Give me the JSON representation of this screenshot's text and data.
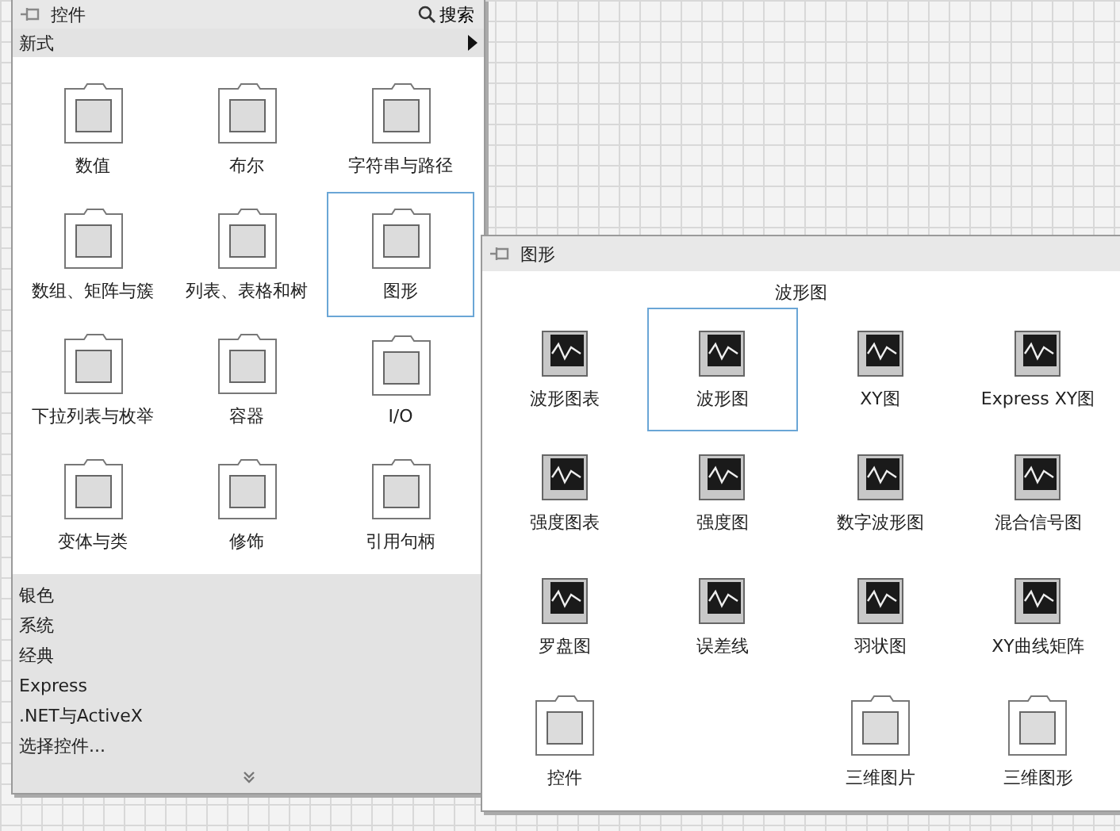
{
  "palette": {
    "title": "控件",
    "search": "搜索",
    "category": "新式",
    "items": [
      {
        "label": "数值",
        "kind": "folder",
        "selected": false
      },
      {
        "label": "布尔",
        "kind": "folder",
        "selected": false
      },
      {
        "label": "字符串与路径",
        "kind": "folder",
        "selected": false
      },
      {
        "label": "数组、矩阵与簇",
        "kind": "folder",
        "selected": false
      },
      {
        "label": "列表、表格和树",
        "kind": "folder",
        "selected": false
      },
      {
        "label": "图形",
        "kind": "folder",
        "selected": true
      },
      {
        "label": "下拉列表与枚举",
        "kind": "folder",
        "selected": false
      },
      {
        "label": "容器",
        "kind": "folder",
        "selected": false
      },
      {
        "label": "I/O",
        "kind": "folder",
        "selected": false
      },
      {
        "label": "变体与类",
        "kind": "folder",
        "selected": false
      },
      {
        "label": "修饰",
        "kind": "folder",
        "selected": false
      },
      {
        "label": "引用句柄",
        "kind": "folder",
        "selected": false
      }
    ],
    "sections": [
      "银色",
      "系统",
      "经典",
      "Express",
      ".NET与ActiveX",
      "选择控件..."
    ]
  },
  "subpalette": {
    "title": "图形",
    "group": "波形图",
    "items": [
      {
        "label": "波形图表",
        "kind": "graph",
        "selected": false
      },
      {
        "label": "波形图",
        "kind": "graph",
        "selected": true
      },
      {
        "label": "XY图",
        "kind": "graph",
        "selected": false
      },
      {
        "label": "Express XY图",
        "kind": "graph",
        "selected": false
      },
      {
        "label": "强度图表",
        "kind": "graph",
        "selected": false
      },
      {
        "label": "强度图",
        "kind": "graph",
        "selected": false
      },
      {
        "label": "数字波形图",
        "kind": "graph",
        "selected": false
      },
      {
        "label": "混合信号图",
        "kind": "graph",
        "selected": false
      },
      {
        "label": "罗盘图",
        "kind": "graph",
        "selected": false
      },
      {
        "label": "误差线",
        "kind": "graph",
        "selected": false
      },
      {
        "label": "羽状图",
        "kind": "graph",
        "selected": false
      },
      {
        "label": "XY曲线矩阵",
        "kind": "graph",
        "selected": false
      },
      {
        "label": "控件",
        "kind": "folder",
        "selected": false
      },
      {
        "kind": "empty"
      },
      {
        "label": "三维图片",
        "kind": "folder",
        "selected": false
      },
      {
        "label": "三维图形",
        "kind": "folder",
        "selected": false
      }
    ]
  }
}
